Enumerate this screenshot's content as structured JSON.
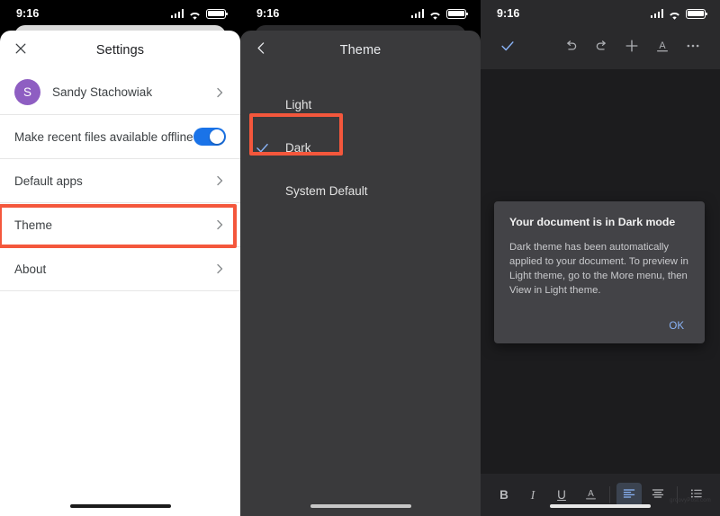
{
  "meta": {
    "accent_blue": "#1a73e8",
    "link_blue": "#8ab4f8",
    "highlight_red": "#f4573c",
    "avatar_purple": "#8e5ec2"
  },
  "panel1": {
    "status": {
      "time": "9:16",
      "signal_icon": "cellular-signal-icon",
      "wifi_icon": "wifi-icon",
      "battery_icon": "battery-icon"
    },
    "header": {
      "close_icon": "close-icon",
      "title": "Settings"
    },
    "account": {
      "avatar_initial": "S",
      "name": "Sandy Stachowiak",
      "chevron_icon": "chevron-right-icon"
    },
    "rows": [
      {
        "label": "Make recent files available offline",
        "control": "toggle",
        "toggle_on": true
      },
      {
        "label": "Default apps",
        "control": "chevron"
      },
      {
        "label": "Theme",
        "control": "chevron",
        "highlighted": true
      },
      {
        "label": "About",
        "control": "chevron"
      }
    ]
  },
  "panel2": {
    "status": {
      "time": "9:16",
      "signal_icon": "cellular-signal-icon",
      "wifi_icon": "wifi-icon",
      "battery_icon": "battery-icon"
    },
    "header": {
      "back_icon": "chevron-left-icon",
      "title": "Theme"
    },
    "options": [
      {
        "label": "Light",
        "selected": false
      },
      {
        "label": "Dark",
        "selected": true,
        "highlighted": true,
        "check_icon": "check-icon"
      },
      {
        "label": "System Default",
        "selected": false
      }
    ]
  },
  "panel3": {
    "status": {
      "time": "9:16",
      "signal_icon": "cellular-signal-icon",
      "wifi_icon": "wifi-icon",
      "battery_icon": "battery-icon"
    },
    "toolbar": [
      {
        "name": "done-check",
        "icon": "check-icon",
        "label": ""
      },
      {
        "name": "undo",
        "icon": "undo-icon",
        "label": ""
      },
      {
        "name": "redo",
        "icon": "redo-icon",
        "label": ""
      },
      {
        "name": "insert",
        "icon": "plus-icon",
        "label": ""
      },
      {
        "name": "text-format",
        "icon": "text-format-a-icon",
        "label": "A"
      },
      {
        "name": "more",
        "icon": "more-horizontal-icon",
        "label": ""
      }
    ],
    "dialog": {
      "title": "Your document is in Dark mode",
      "body": "Dark theme has been automatically applied to your document. To preview in Light theme, go to the More menu, then View in Light theme.",
      "ok_label": "OK"
    },
    "format_bar": [
      {
        "name": "bold",
        "label": "B",
        "active": false
      },
      {
        "name": "italic",
        "label": "I",
        "active": false
      },
      {
        "name": "underline",
        "label": "U",
        "active": false
      },
      {
        "name": "text-color",
        "label": "A",
        "active": false
      },
      {
        "name": "align-left",
        "label": "",
        "icon": "align-left-icon",
        "active": true
      },
      {
        "name": "align-center",
        "label": "",
        "icon": "align-center-icon",
        "active": false
      },
      {
        "name": "bulleted-list",
        "label": "",
        "icon": "bulleted-list-icon",
        "active": false
      }
    ],
    "watermark": "groovyPost.com"
  }
}
